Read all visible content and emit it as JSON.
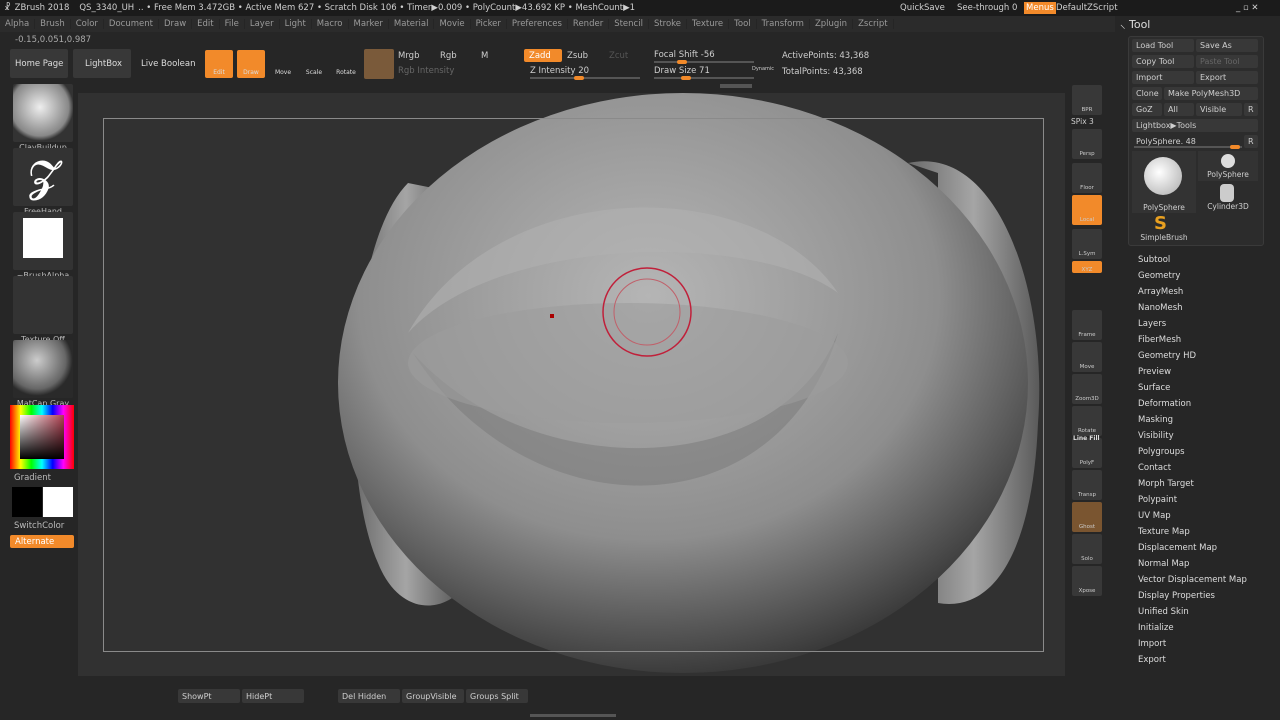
{
  "titlebar": {
    "app": "ZBrush 2018",
    "file": "QS_3340_UH",
    "stats": ".. • Free Mem 3.472GB • Active Mem 627 • Scratch Disk 106 • Timer▶0.009 • PolyCount▶43.692 KP • MeshCount▶1",
    "quicksave": "QuickSave",
    "seethrough": "See-through  0",
    "menus": "Menus",
    "script": "DefaultZScript"
  },
  "menu": [
    "Alpha",
    "Brush",
    "Color",
    "Document",
    "Draw",
    "Edit",
    "File",
    "Layer",
    "Light",
    "Macro",
    "Marker",
    "Material",
    "Movie",
    "Picker",
    "Preferences",
    "Render",
    "Stencil",
    "Stroke",
    "Texture",
    "Tool",
    "Transform",
    "Zplugin",
    "Zscript"
  ],
  "coords": "-0.15,0.051,0.987",
  "toolbar": {
    "home": "Home Page",
    "lightbox": "LightBox",
    "liveboolean": "Live Boolean",
    "edit": "Edit",
    "draw": "Draw",
    "move": "Move",
    "scale": "Scale",
    "rotate": "Rotate",
    "mrgb": "Mrgb",
    "rgb": "Rgb",
    "m": "M",
    "rgbint": "Rgb Intensity",
    "zadd": "Zadd",
    "zsub": "Zsub",
    "zcut": "Zcut",
    "zint": "Z Intensity 20",
    "focal": "Focal Shift -56",
    "drawsize": "Draw Size 71",
    "dynamic": "Dynamic",
    "active": "ActivePoints: 43,368",
    "total": "TotalPoints: 43,368",
    "z_intensity": 20,
    "focal_shift": -56,
    "draw_size": 71
  },
  "left": {
    "brush": "ClayBuildup",
    "stroke": "FreeHand",
    "alpha": "~BrushAlpha",
    "texture": "Texture Off",
    "material": "MatCap Gray",
    "gradient": "Gradient",
    "switchcolor": "SwitchColor",
    "alternate": "Alternate"
  },
  "shelf": {
    "bpr": "BPR",
    "spix": "SPix 3",
    "persp": "Persp",
    "floor": "Floor",
    "local": "Local",
    "lsym": "L.Sym",
    "xyz": "XYZ",
    "frame": "Frame",
    "move": "Move",
    "zoom": "Zoom3D",
    "rotate": "Rotate",
    "linefill": "Line Fill",
    "polyf": "PolyF",
    "transp": "Transp",
    "ghost": "Ghost",
    "solo": "Solo",
    "xpose": "Xpose",
    "dynamic": "Dynamic"
  },
  "tool": {
    "title": "Tool",
    "load": "Load Tool",
    "saveas": "Save As",
    "copy": "Copy Tool",
    "paste": "Paste Tool",
    "import": "Import",
    "export": "Export",
    "clone": "Clone",
    "make": "Make PolyMesh3D",
    "goz": "GoZ",
    "all": "All",
    "visible": "Visible",
    "r": "R",
    "lightbox": "Lightbox▶Tools",
    "polysphere": "PolySphere. 48",
    "thumbs": [
      "PolySphere",
      "PolySphere",
      "Cylinder3D",
      "SimpleBrush"
    ]
  },
  "subpalettes": [
    "Subtool",
    "Geometry",
    "ArrayMesh",
    "NanoMesh",
    "Layers",
    "FiberMesh",
    "Geometry HD",
    "Preview",
    "Surface",
    "Deformation",
    "Masking",
    "Visibility",
    "Polygroups",
    "Contact",
    "Morph Target",
    "Polypaint",
    "UV Map",
    "Texture Map",
    "Displacement Map",
    "Normal Map",
    "Vector Displacement Map",
    "Display Properties",
    "Unified Skin",
    "Initialize",
    "Import",
    "Export"
  ],
  "bottom": {
    "showpt": "ShowPt",
    "hidept": "HidePt",
    "delhidden": "Del Hidden",
    "groupvisible": "GroupVisible",
    "groupssplit": "Groups Split"
  },
  "colors": {
    "accent": "#f28a2a"
  }
}
